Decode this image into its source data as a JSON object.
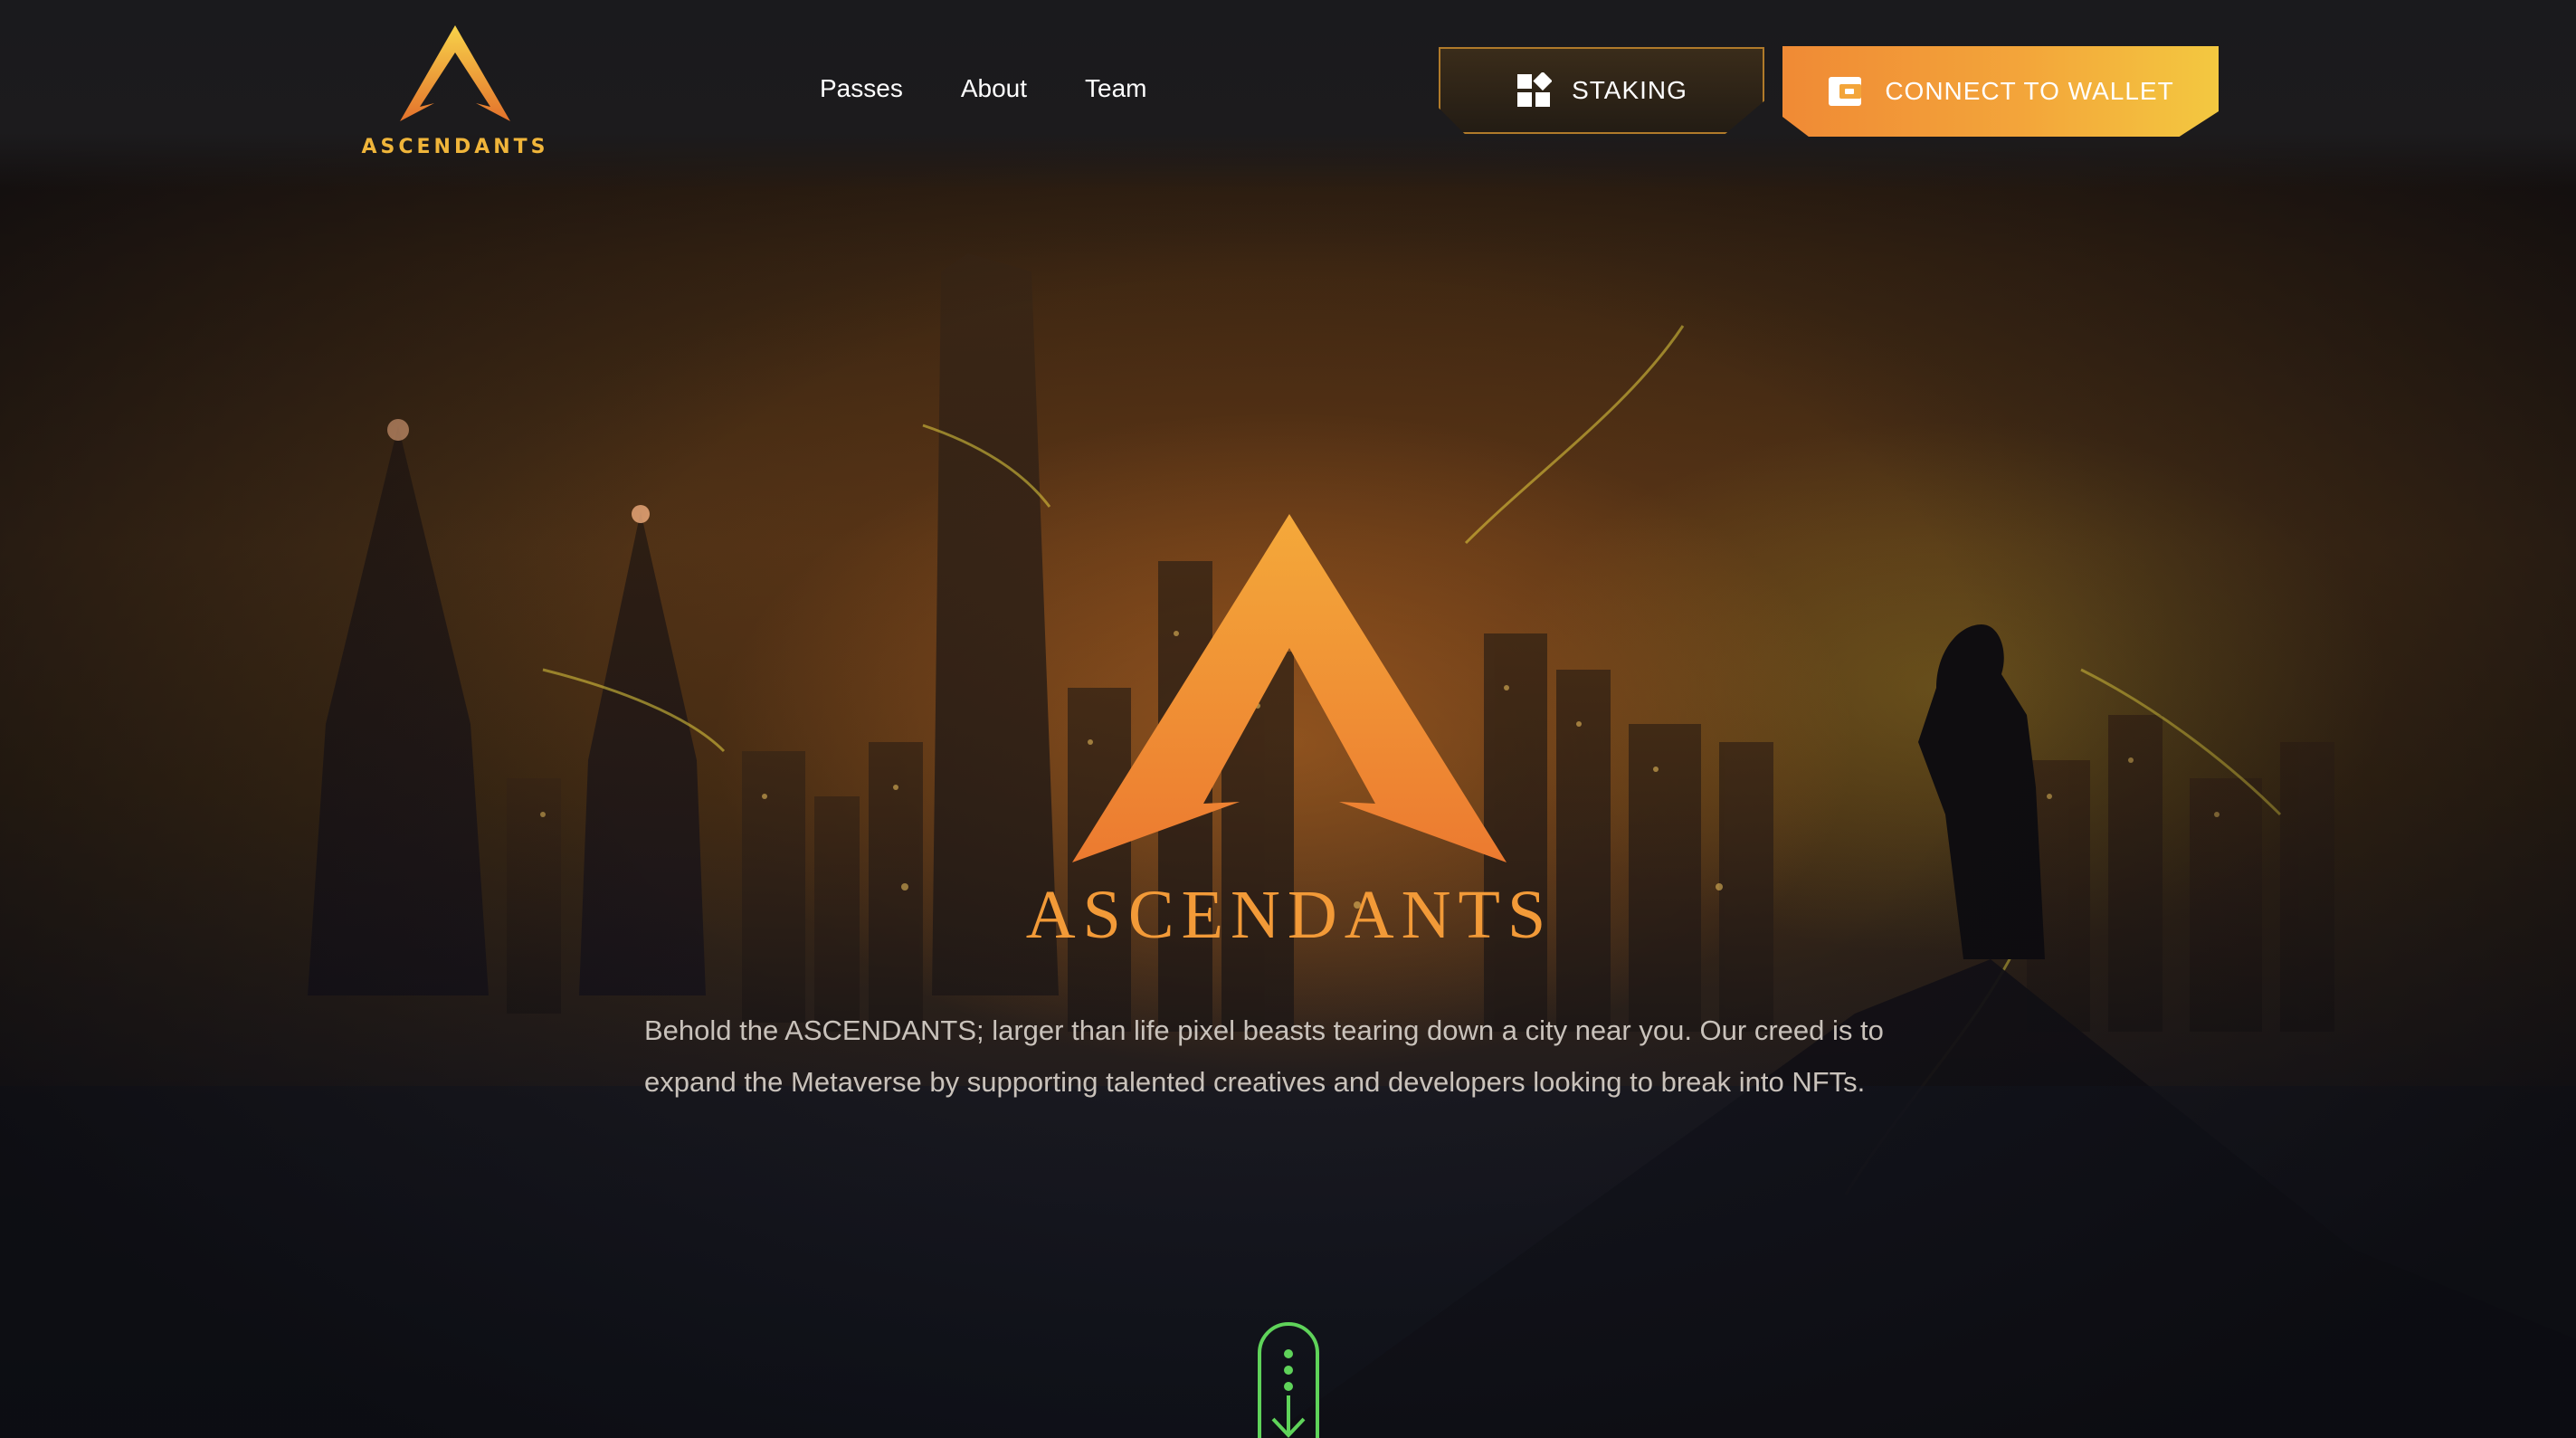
{
  "header": {
    "logo_text": "ASCENDANTS",
    "nav": [
      {
        "label": "Passes"
      },
      {
        "label": "About"
      },
      {
        "label": "Team"
      }
    ],
    "staking_button": {
      "label": "STAKING",
      "icon": "dashboard-icon"
    },
    "wallet_button": {
      "label": "CONNECT TO WALLET",
      "icon": "wallet-icon"
    }
  },
  "hero": {
    "title": "ASCENDANTS",
    "description": "Behold the ASCENDANTS; larger than life pixel beasts tearing down a city near you. Our creed is to expand the Metaverse by supporting talented creatives and developers looking to break into NFTs.",
    "scroll_icon": "scroll-down-icon"
  },
  "colors": {
    "accent_orange": "#f08a35",
    "accent_yellow": "#f3c840",
    "scroll_green": "#5fd35a",
    "header_bg": "#1a1a1d"
  }
}
